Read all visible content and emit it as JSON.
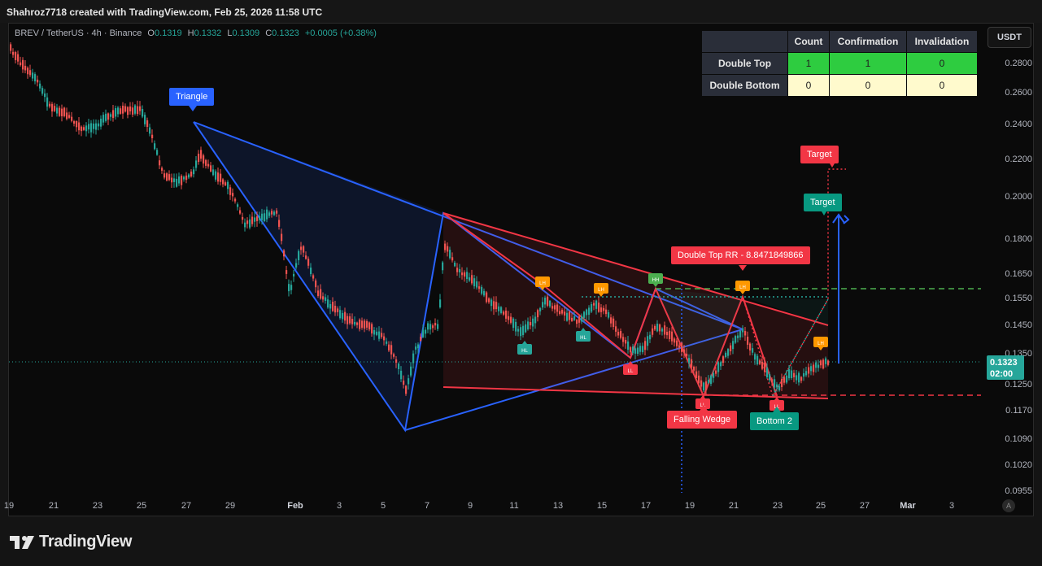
{
  "header": {
    "attribution": "Shahroz7718 created with TradingView.com, Feb 25, 2026 11:58 UTC"
  },
  "symbol": {
    "name": "BREV / TetherUS · 4h · Binance",
    "o_label": "O",
    "o_value": "0.1319",
    "h_label": "H",
    "h_value": "0.1332",
    "l_label": "L",
    "l_value": "0.1309",
    "c_label": "C",
    "c_value": "0.1323",
    "change": "+0.0005 (+0.38%)"
  },
  "stats_table": {
    "headers": [
      "Count",
      "Confirmation",
      "Invalidation"
    ],
    "rows": [
      {
        "label": "Double Top",
        "values": [
          "1",
          "1",
          "0"
        ]
      },
      {
        "label": "Double Bottom",
        "values": [
          "0",
          "0",
          "0"
        ]
      }
    ]
  },
  "currency_button": "USDT",
  "price_axis": [
    "0.2800",
    "0.2600",
    "0.2400",
    "0.2200",
    "0.2000",
    "0.1800",
    "0.1650",
    "0.1550",
    "0.1450",
    "0.1350",
    "0.1250",
    "0.1170",
    "0.1090",
    "0.1020",
    "0.0955"
  ],
  "current_price": {
    "price": "0.1323",
    "countdown": "02:00"
  },
  "time_axis": [
    {
      "label": "19",
      "bold": false
    },
    {
      "label": "21",
      "bold": false
    },
    {
      "label": "23",
      "bold": false
    },
    {
      "label": "25",
      "bold": false
    },
    {
      "label": "27",
      "bold": false
    },
    {
      "label": "29",
      "bold": false
    },
    {
      "label": "Feb",
      "bold": true
    },
    {
      "label": "3",
      "bold": false
    },
    {
      "label": "5",
      "bold": false
    },
    {
      "label": "7",
      "bold": false
    },
    {
      "label": "9",
      "bold": false
    },
    {
      "label": "11",
      "bold": false
    },
    {
      "label": "13",
      "bold": false
    },
    {
      "label": "15",
      "bold": false
    },
    {
      "label": "17",
      "bold": false
    },
    {
      "label": "19",
      "bold": false
    },
    {
      "label": "21",
      "bold": false
    },
    {
      "label": "23",
      "bold": false
    },
    {
      "label": "25",
      "bold": false
    },
    {
      "label": "27",
      "bold": false
    },
    {
      "label": "Mar",
      "bold": true
    },
    {
      "label": "3",
      "bold": false
    }
  ],
  "annotations": {
    "triangle": "Triangle",
    "falling_wedge": "Falling Wedge",
    "bottom2": "Bottom 2",
    "double_top_rr": "Double Top RR - 8.8471849866",
    "target_red": "Target",
    "target_green": "Target",
    "pivots": [
      "LH",
      "LH",
      "HH",
      "LH",
      "LH",
      "HL",
      "HL",
      "LL",
      "LL",
      "LL"
    ]
  },
  "auto_button": "A",
  "brand": "TradingView",
  "colors": {
    "up": "#26a69a",
    "down": "#ef5350",
    "blue": "#2962ff",
    "red": "#f23645",
    "green_tag": "#089981",
    "orange": "#ff9800"
  }
}
